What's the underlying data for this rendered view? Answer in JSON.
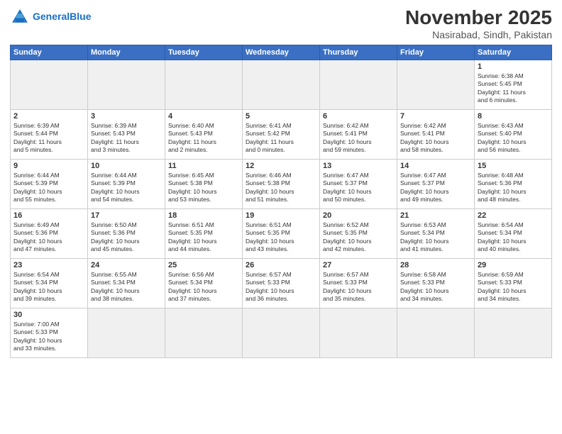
{
  "header": {
    "logo_general": "General",
    "logo_blue": "Blue",
    "title": "November 2025",
    "subtitle": "Nasirabad, Sindh, Pakistan"
  },
  "weekdays": [
    "Sunday",
    "Monday",
    "Tuesday",
    "Wednesday",
    "Thursday",
    "Friday",
    "Saturday"
  ],
  "weeks": [
    [
      {
        "day": "",
        "info": ""
      },
      {
        "day": "",
        "info": ""
      },
      {
        "day": "",
        "info": ""
      },
      {
        "day": "",
        "info": ""
      },
      {
        "day": "",
        "info": ""
      },
      {
        "day": "",
        "info": ""
      },
      {
        "day": "1",
        "info": "Sunrise: 6:38 AM\nSunset: 5:45 PM\nDaylight: 11 hours\nand 6 minutes."
      }
    ],
    [
      {
        "day": "2",
        "info": "Sunrise: 6:39 AM\nSunset: 5:44 PM\nDaylight: 11 hours\nand 5 minutes."
      },
      {
        "day": "3",
        "info": "Sunrise: 6:39 AM\nSunset: 5:43 PM\nDaylight: 11 hours\nand 3 minutes."
      },
      {
        "day": "4",
        "info": "Sunrise: 6:40 AM\nSunset: 5:43 PM\nDaylight: 11 hours\nand 2 minutes."
      },
      {
        "day": "5",
        "info": "Sunrise: 6:41 AM\nSunset: 5:42 PM\nDaylight: 11 hours\nand 0 minutes."
      },
      {
        "day": "6",
        "info": "Sunrise: 6:42 AM\nSunset: 5:41 PM\nDaylight: 10 hours\nand 59 minutes."
      },
      {
        "day": "7",
        "info": "Sunrise: 6:42 AM\nSunset: 5:41 PM\nDaylight: 10 hours\nand 58 minutes."
      },
      {
        "day": "8",
        "info": "Sunrise: 6:43 AM\nSunset: 5:40 PM\nDaylight: 10 hours\nand 56 minutes."
      }
    ],
    [
      {
        "day": "9",
        "info": "Sunrise: 6:44 AM\nSunset: 5:39 PM\nDaylight: 10 hours\nand 55 minutes."
      },
      {
        "day": "10",
        "info": "Sunrise: 6:44 AM\nSunset: 5:39 PM\nDaylight: 10 hours\nand 54 minutes."
      },
      {
        "day": "11",
        "info": "Sunrise: 6:45 AM\nSunset: 5:38 PM\nDaylight: 10 hours\nand 53 minutes."
      },
      {
        "day": "12",
        "info": "Sunrise: 6:46 AM\nSunset: 5:38 PM\nDaylight: 10 hours\nand 51 minutes."
      },
      {
        "day": "13",
        "info": "Sunrise: 6:47 AM\nSunset: 5:37 PM\nDaylight: 10 hours\nand 50 minutes."
      },
      {
        "day": "14",
        "info": "Sunrise: 6:47 AM\nSunset: 5:37 PM\nDaylight: 10 hours\nand 49 minutes."
      },
      {
        "day": "15",
        "info": "Sunrise: 6:48 AM\nSunset: 5:36 PM\nDaylight: 10 hours\nand 48 minutes."
      }
    ],
    [
      {
        "day": "16",
        "info": "Sunrise: 6:49 AM\nSunset: 5:36 PM\nDaylight: 10 hours\nand 47 minutes."
      },
      {
        "day": "17",
        "info": "Sunrise: 6:50 AM\nSunset: 5:36 PM\nDaylight: 10 hours\nand 45 minutes."
      },
      {
        "day": "18",
        "info": "Sunrise: 6:51 AM\nSunset: 5:35 PM\nDaylight: 10 hours\nand 44 minutes."
      },
      {
        "day": "19",
        "info": "Sunrise: 6:51 AM\nSunset: 5:35 PM\nDaylight: 10 hours\nand 43 minutes."
      },
      {
        "day": "20",
        "info": "Sunrise: 6:52 AM\nSunset: 5:35 PM\nDaylight: 10 hours\nand 42 minutes."
      },
      {
        "day": "21",
        "info": "Sunrise: 6:53 AM\nSunset: 5:34 PM\nDaylight: 10 hours\nand 41 minutes."
      },
      {
        "day": "22",
        "info": "Sunrise: 6:54 AM\nSunset: 5:34 PM\nDaylight: 10 hours\nand 40 minutes."
      }
    ],
    [
      {
        "day": "23",
        "info": "Sunrise: 6:54 AM\nSunset: 5:34 PM\nDaylight: 10 hours\nand 39 minutes."
      },
      {
        "day": "24",
        "info": "Sunrise: 6:55 AM\nSunset: 5:34 PM\nDaylight: 10 hours\nand 38 minutes."
      },
      {
        "day": "25",
        "info": "Sunrise: 6:56 AM\nSunset: 5:34 PM\nDaylight: 10 hours\nand 37 minutes."
      },
      {
        "day": "26",
        "info": "Sunrise: 6:57 AM\nSunset: 5:33 PM\nDaylight: 10 hours\nand 36 minutes."
      },
      {
        "day": "27",
        "info": "Sunrise: 6:57 AM\nSunset: 5:33 PM\nDaylight: 10 hours\nand 35 minutes."
      },
      {
        "day": "28",
        "info": "Sunrise: 6:58 AM\nSunset: 5:33 PM\nDaylight: 10 hours\nand 34 minutes."
      },
      {
        "day": "29",
        "info": "Sunrise: 6:59 AM\nSunset: 5:33 PM\nDaylight: 10 hours\nand 34 minutes."
      }
    ],
    [
      {
        "day": "30",
        "info": "Sunrise: 7:00 AM\nSunset: 5:33 PM\nDaylight: 10 hours\nand 33 minutes."
      },
      {
        "day": "",
        "info": ""
      },
      {
        "day": "",
        "info": ""
      },
      {
        "day": "",
        "info": ""
      },
      {
        "day": "",
        "info": ""
      },
      {
        "day": "",
        "info": ""
      },
      {
        "day": "",
        "info": ""
      }
    ]
  ]
}
